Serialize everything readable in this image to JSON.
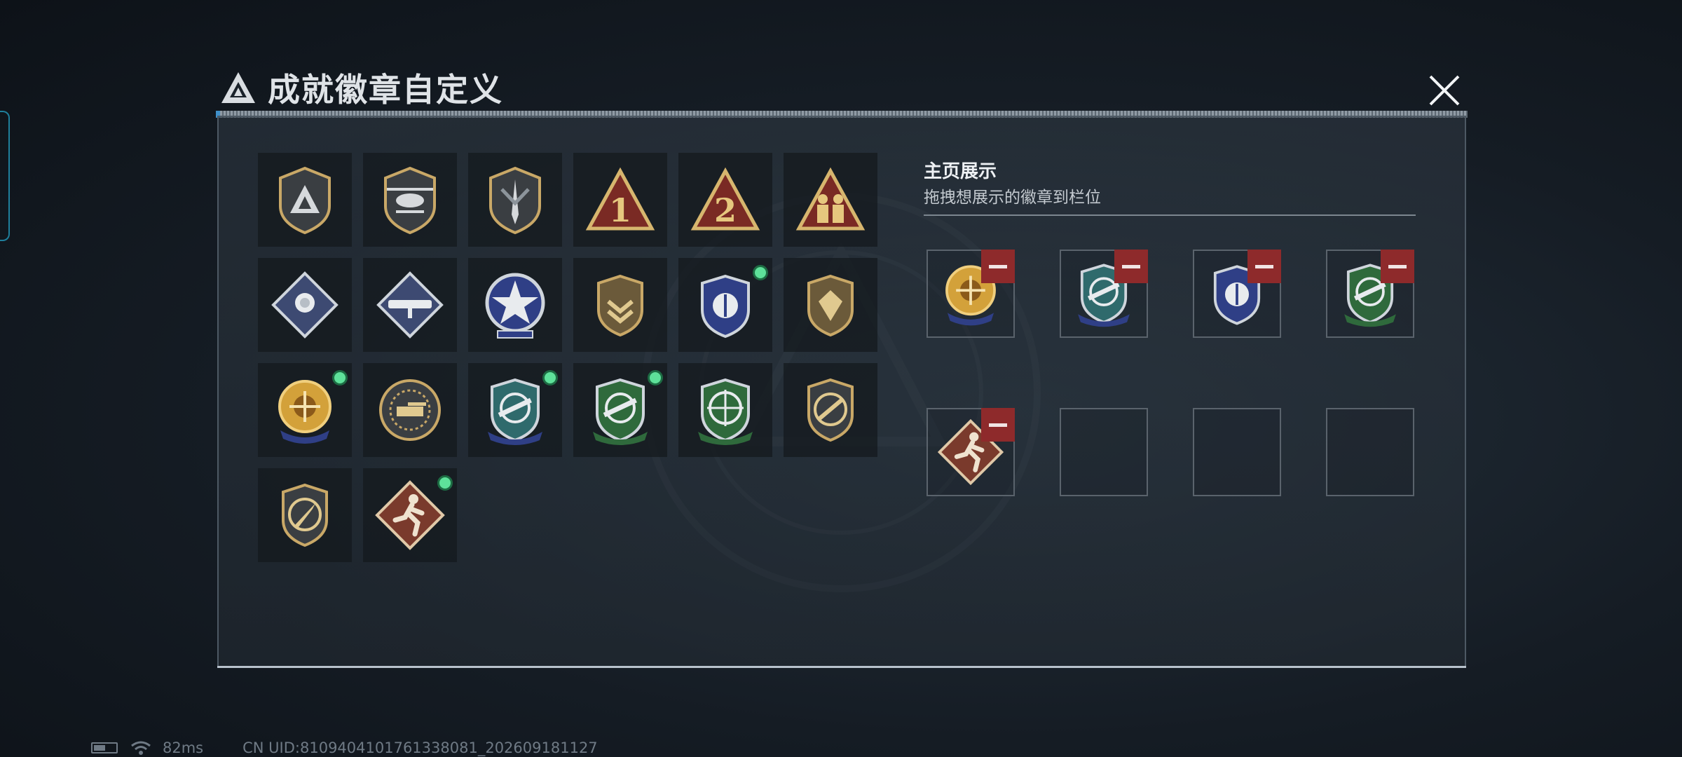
{
  "dialog": {
    "title": "成就徽章自定义",
    "close_icon": "close-icon"
  },
  "badges": [
    {
      "icon": "gold-triangle-shield-badge",
      "new": false
    },
    {
      "icon": "helicopter-shield-badge",
      "new": false
    },
    {
      "icon": "dagger-shield-badge",
      "new": false
    },
    {
      "icon": "rank-1-triangle-badge",
      "new": false
    },
    {
      "icon": "rank-2-triangle-badge",
      "new": false
    },
    {
      "icon": "soldiers-triangle-badge",
      "new": false
    },
    {
      "icon": "rose-diamond-badge",
      "new": false
    },
    {
      "icon": "rocket-launcher-diamond-badge",
      "new": false
    },
    {
      "icon": "star-medal-badge",
      "new": false
    },
    {
      "icon": "gold-chevron-shield-badge",
      "new": false
    },
    {
      "icon": "navy-eagle-shield-badge",
      "new": true
    },
    {
      "icon": "diamond-gem-shield-badge",
      "new": false
    },
    {
      "icon": "gold-crosshair-medal-badge",
      "new": true
    },
    {
      "icon": "tank-sun-badge",
      "new": false
    },
    {
      "icon": "blue-rifle-shield-badge",
      "new": true
    },
    {
      "icon": "green-rifle-shield-badge",
      "new": true
    },
    {
      "icon": "green-crosshair-rifle-badge",
      "new": false
    },
    {
      "icon": "gold-knife-circle-shield-badge",
      "new": false
    },
    {
      "icon": "gold-knife-shield-badge",
      "new": false
    },
    {
      "icon": "running-soldier-diamond-badge",
      "new": true
    }
  ],
  "showcase": {
    "title": "主页展示",
    "subtitle": "拖拽想展示的徽章到栏位",
    "slots": [
      {
        "icon": "gold-crosshair-medal-badge",
        "filled": true
      },
      {
        "icon": "blue-rifle-shield-badge",
        "filled": true
      },
      {
        "icon": "navy-eagle-shield-badge",
        "filled": true
      },
      {
        "icon": "green-rifle-shield-badge",
        "filled": true
      },
      {
        "icon": "running-soldier-diamond-badge",
        "filled": true
      },
      {
        "icon": "",
        "filled": false
      },
      {
        "icon": "",
        "filled": false
      },
      {
        "icon": "",
        "filled": false
      }
    ],
    "remove_icon": "minus-icon"
  },
  "status": {
    "ping": "82ms",
    "uid": "CN UID:8109404101761338081_202609181127"
  },
  "colors": {
    "gold": "#c9a867",
    "navy": "#2f3f86",
    "green": "#2f6a3c",
    "remove_red": "#8e2a2b",
    "new_dot": "#5ee19a"
  }
}
